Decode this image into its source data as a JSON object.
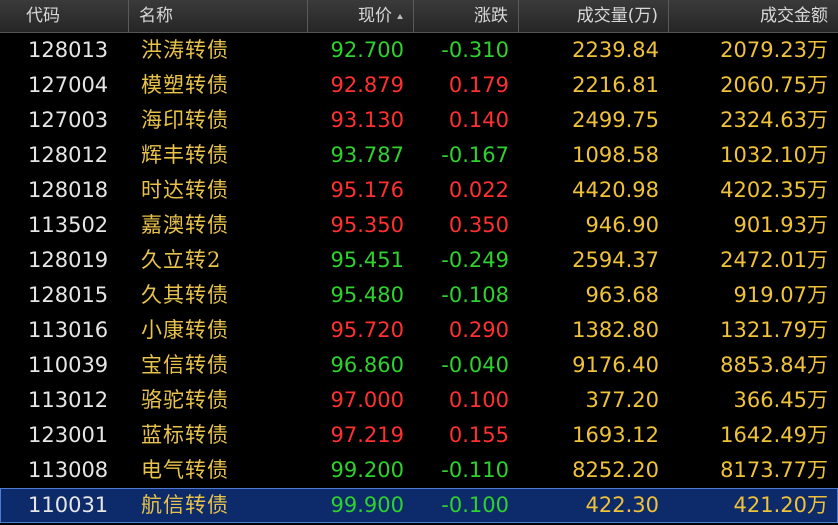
{
  "colors": {
    "up": "#ff3030",
    "down": "#2ed12e",
    "name": "#e8c24a",
    "volume": "#f0c23a",
    "selected_row": "#0d2a6a"
  },
  "header": {
    "code": "代码",
    "name": "名称",
    "price": "现价",
    "change": "涨跌",
    "volume": "成交量(万)",
    "amount": "成交金额",
    "sort_icon": "sort-ascending-icon"
  },
  "rows": [
    {
      "code": "128013",
      "name": "洪涛转债",
      "price": "92.700",
      "change": "-0.310",
      "dir": "down",
      "volume": "2239.84",
      "amount": "2079.23",
      "unit": "万"
    },
    {
      "code": "127004",
      "name": "模塑转债",
      "price": "92.879",
      "change": "0.179",
      "dir": "up",
      "volume": "2216.81",
      "amount": "2060.75",
      "unit": "万"
    },
    {
      "code": "127003",
      "name": "海印转债",
      "price": "93.130",
      "change": "0.140",
      "dir": "up",
      "volume": "2499.75",
      "amount": "2324.63",
      "unit": "万"
    },
    {
      "code": "128012",
      "name": "辉丰转债",
      "price": "93.787",
      "change": "-0.167",
      "dir": "down",
      "volume": "1098.58",
      "amount": "1032.10",
      "unit": "万"
    },
    {
      "code": "128018",
      "name": "时达转债",
      "price": "95.176",
      "change": "0.022",
      "dir": "up",
      "volume": "4420.98",
      "amount": "4202.35",
      "unit": "万"
    },
    {
      "code": "113502",
      "name": "嘉澳转债",
      "price": "95.350",
      "change": "0.350",
      "dir": "up",
      "volume": "946.90",
      "amount": "901.93",
      "unit": "万"
    },
    {
      "code": "128019",
      "name": "久立转2",
      "price": "95.451",
      "change": "-0.249",
      "dir": "down",
      "volume": "2594.37",
      "amount": "2472.01",
      "unit": "万"
    },
    {
      "code": "128015",
      "name": "久其转债",
      "price": "95.480",
      "change": "-0.108",
      "dir": "down",
      "volume": "963.68",
      "amount": "919.07",
      "unit": "万"
    },
    {
      "code": "113016",
      "name": "小康转债",
      "price": "95.720",
      "change": "0.290",
      "dir": "up",
      "volume": "1382.80",
      "amount": "1321.79",
      "unit": "万"
    },
    {
      "code": "110039",
      "name": "宝信转债",
      "price": "96.860",
      "change": "-0.040",
      "dir": "down",
      "volume": "9176.40",
      "amount": "8853.84",
      "unit": "万"
    },
    {
      "code": "113012",
      "name": "骆驼转债",
      "price": "97.000",
      "change": "0.100",
      "dir": "up",
      "volume": "377.20",
      "amount": "366.45",
      "unit": "万"
    },
    {
      "code": "123001",
      "name": "蓝标转债",
      "price": "97.219",
      "change": "0.155",
      "dir": "up",
      "volume": "1693.12",
      "amount": "1642.49",
      "unit": "万"
    },
    {
      "code": "113008",
      "name": "电气转债",
      "price": "99.200",
      "change": "-0.110",
      "dir": "down",
      "volume": "8252.20",
      "amount": "8173.77",
      "unit": "万"
    },
    {
      "code": "110031",
      "name": "航信转债",
      "price": "99.900",
      "change": "-0.100",
      "dir": "down",
      "volume": "422.30",
      "amount": "421.20",
      "unit": "万",
      "selected": true
    }
  ]
}
